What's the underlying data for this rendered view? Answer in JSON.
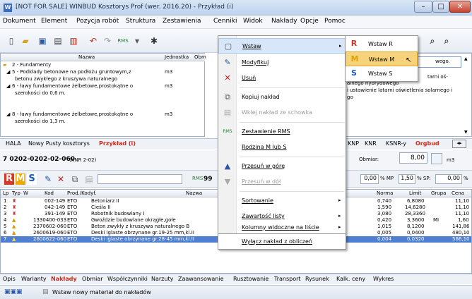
{
  "window": {
    "title": "[NOT FOR SALE] WINBUD Kosztorys Prof (wer. 2016.20) - Przykład (i)",
    "min": "–",
    "max": "□",
    "close": "✕"
  },
  "menu": [
    "Dokument",
    "Element",
    "Pozycja robót",
    "Struktura",
    "Zestawienia",
    "Cenniki",
    "Widok",
    "Nakłady",
    "Opcje",
    "Pomoc"
  ],
  "tree": {
    "headers": {
      "name": "Nazwa",
      "unit": "Jednostka",
      "obm": "Obm"
    },
    "rows": [
      {
        "text": "2 - Fundamenty",
        "unit": ""
      },
      {
        "text": "5 - Podkłady betonowe na podłożu gruntowym,z",
        "unit": "m3"
      },
      {
        "text": "betonu zwykłego z kruszywa naturalnego",
        "unit": ""
      },
      {
        "text": "6 - ławy fundamentowe żelbetowe,prostokątne o",
        "unit": "m3"
      },
      {
        "text": "szerokości do 0,6 m.",
        "unit": ""
      },
      {
        "text": "7 - ławy fundamentowe żelbetowe,prostokątne o",
        "unit": "m3"
      },
      {
        "text": "szerokości do 0,8 m.",
        "unit": ""
      },
      {
        "text": "8 - ławy fundamentowe żelbetowe,prostokątne o",
        "unit": "m3"
      },
      {
        "text": "szerokości do 1,3 m.",
        "unit": ""
      }
    ]
  },
  "rightpane": {
    "l1": "wego.",
    "l2": "tarni oś-",
    "l3": "alnego hybrydowego",
    "l4": "i ustawienie latarni oświetlenia solarnego i",
    "l5": "go"
  },
  "tabs_top": [
    "HALA",
    "Nowy Pusty kosztorys",
    "Przykład (i)",
    "KNP",
    "KNR",
    "KSNR-y",
    "Orgbud"
  ],
  "position": {
    "code": "7  0202-0202-02-060",
    "source": "(KNR 2-02)",
    "obmiar_label": "Obmiar:",
    "obmiar": "8,00",
    "unit": "m3"
  },
  "toolbar2": {
    "rms_r": "R",
    "rms_m": "M",
    "rms_s": "S",
    "mp": "0,00",
    "mp_label": "% MP",
    "sp": "1,50",
    "sp_label": "% SP:",
    "extra": "0,00",
    "extra_label": "%",
    "rms_text": "99"
  },
  "grid": {
    "headers": {
      "lp": "Lp",
      "typ": "Typ",
      "w": "W",
      "kod": "Kod",
      "prod": "Prod./Kodyf.",
      "nazwa": "Nazwa",
      "norma": "Norma",
      "limit": "Limit",
      "grupa": "Grupa",
      "cena": "Cena"
    },
    "rows": [
      {
        "lp": "1",
        "kod": "002-149",
        "prod": "ETO",
        "nazwa": "Betoniarz II",
        "norma": "0,740",
        "limit": "6,8080",
        "grupa": "",
        "cena": "11,10"
      },
      {
        "lp": "2",
        "kod": "042-149",
        "prod": "ETO",
        "nazwa": "Cieśla II",
        "norma": "1,590",
        "limit": "14,6280",
        "grupa": "",
        "cena": "11,10"
      },
      {
        "lp": "3",
        "kod": "391-149",
        "prod": "ETO",
        "nazwa": "Robotnik budowlany I",
        "norma": "3,080",
        "limit": "28,3360",
        "grupa": "",
        "cena": "11,10"
      },
      {
        "lp": "4",
        "kod": "1330400-033",
        "prod": "ETO",
        "nazwa": "Gwoździe budowlane okrągłe,gołe",
        "norma": "0,420",
        "limit": "3,3600",
        "grupa": "MI",
        "cena": "1,60"
      },
      {
        "lp": "5",
        "kod": "2370602-060",
        "prod": "ETO",
        "nazwa": "Beton zwykły z kruszywa naturalnego B",
        "norma": "1,015",
        "limit": "8,1200",
        "grupa": "",
        "cena": "141,86"
      },
      {
        "lp": "6",
        "kod": "2600619-060",
        "prod": "ETO",
        "nazwa": "Deski iglaste obrzynane gr.19-25 mm,kl.II",
        "norma": "0,005",
        "limit": "0,0400",
        "grupa": "",
        "cena": "480,10"
      },
      {
        "lp": "7",
        "kod": "2600622-060",
        "prod": "ETO",
        "nazwa": "Deski iglaste obrzynane gr.28-45 mm,kl.II",
        "norma": "0,004",
        "limit": "0,0320",
        "grupa": "",
        "cena": "566,10"
      }
    ]
  },
  "tabs_bottom": [
    "Opis",
    "Warianty",
    "Nakłady",
    "Obmiar",
    "Współczynniki",
    "Narzuty",
    "Zaawansowanie",
    "Rusztowanie",
    "Transport",
    "Rysunek",
    "Kalk. ceny",
    "Wykres"
  ],
  "status": "Wstaw nowy materiał do nakładów",
  "context_menu": {
    "items": [
      {
        "label": "Wstaw",
        "icon": "insert-icon",
        "glyph": "▢",
        "submenu": true
      },
      {
        "label": "Modyfikuj",
        "icon": "edit-icon",
        "glyph": "✎"
      },
      {
        "label": "Usuń",
        "icon": "delete-icon",
        "glyph": "✕"
      },
      {
        "label": "Kopiuj nakład",
        "icon": "copy-icon",
        "glyph": "⧉"
      },
      {
        "label": "Wklej nakład ze schowka",
        "icon": "paste-icon",
        "glyph": "▤",
        "disabled": true
      },
      {
        "label": "Zestawienie RMS",
        "icon": "rms-icon",
        "glyph": "RMS"
      },
      {
        "label": "Rodzina M lub S",
        "icon": "family-icon",
        "glyph": ""
      },
      {
        "label": "Przesuń w górę",
        "icon": "arrow-up-icon",
        "glyph": "▲"
      },
      {
        "label": "Przesuń w dół",
        "icon": "arrow-down-icon",
        "glyph": "▼",
        "disabled": true
      },
      {
        "label": "Sortowanie",
        "submenu": true
      },
      {
        "label": "Zawartość listy",
        "submenu": true
      },
      {
        "label": "Kolumny widoczne na liście",
        "submenu": true
      },
      {
        "label": "Wyłącz nakład z obliczeń"
      }
    ]
  },
  "submenu": [
    {
      "glyph": "R",
      "label": "Wstaw R",
      "color": "#c8372a"
    },
    {
      "glyph": "M",
      "label": "Wstaw M",
      "color": "#e3a000"
    },
    {
      "glyph": "S",
      "label": "Wstaw S",
      "color": "#1b58b5"
    }
  ]
}
